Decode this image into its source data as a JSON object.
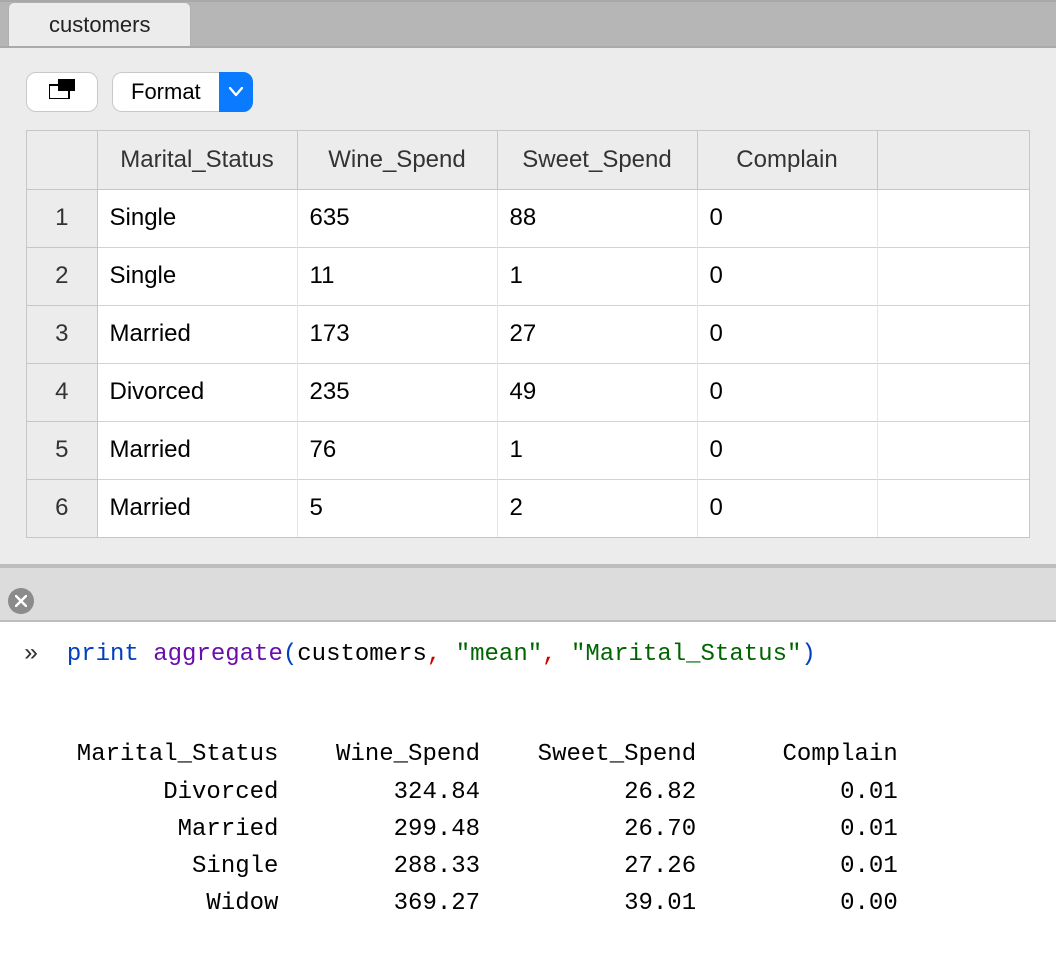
{
  "tab": {
    "label": "customers"
  },
  "toolbar": {
    "format_label": "Format"
  },
  "table": {
    "headers": [
      "Marital_Status",
      "Wine_Spend",
      "Sweet_Spend",
      "Complain"
    ],
    "rows": [
      {
        "n": "1",
        "cells": [
          "Single",
          "635",
          "88",
          "0"
        ]
      },
      {
        "n": "2",
        "cells": [
          "Single",
          "11",
          "1",
          "0"
        ]
      },
      {
        "n": "3",
        "cells": [
          "Married",
          "173",
          "27",
          "0"
        ]
      },
      {
        "n": "4",
        "cells": [
          "Divorced",
          "235",
          "49",
          "0"
        ]
      },
      {
        "n": "5",
        "cells": [
          "Married",
          "76",
          "1",
          "0"
        ]
      },
      {
        "n": "6",
        "cells": [
          "Married",
          "5",
          "2",
          "0"
        ]
      }
    ]
  },
  "console": {
    "prompt_glyph": "»",
    "code": {
      "print_kw": "print",
      "func": "aggregate",
      "arg_ident": "customers",
      "arg_str1": "\"mean\"",
      "arg_str2": "\"Marital_Status\""
    },
    "output_header": "  Marital_Status    Wine_Spend    Sweet_Spend      Complain",
    "output_rows": [
      "        Divorced        324.84          26.82          0.01",
      "         Married        299.48          26.70          0.01",
      "          Single        288.33          27.26          0.01",
      "           Widow        369.27          39.01          0.00"
    ]
  },
  "chart_data": {
    "type": "table",
    "title": "aggregate(customers, \"mean\", \"Marital_Status\")",
    "columns": [
      "Marital_Status",
      "Wine_Spend",
      "Sweet_Spend",
      "Complain"
    ],
    "rows": [
      {
        "Marital_Status": "Divorced",
        "Wine_Spend": 324.84,
        "Sweet_Spend": 26.82,
        "Complain": 0.01
      },
      {
        "Marital_Status": "Married",
        "Wine_Spend": 299.48,
        "Sweet_Spend": 26.7,
        "Complain": 0.01
      },
      {
        "Marital_Status": "Single",
        "Wine_Spend": 288.33,
        "Sweet_Spend": 27.26,
        "Complain": 0.01
      },
      {
        "Marital_Status": "Widow",
        "Wine_Spend": 369.27,
        "Sweet_Spend": 39.01,
        "Complain": 0.0
      }
    ]
  }
}
